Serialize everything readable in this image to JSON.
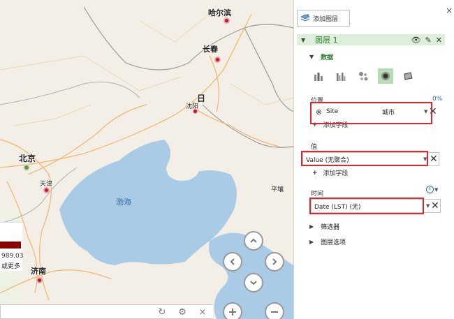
{
  "map": {
    "cities": {
      "haerbin": "哈尔滨",
      "changchun": "长春",
      "shenyang": "沈阳",
      "beijing": "北京",
      "tianjin": "天津",
      "jinan": "济南",
      "pingrang": "平壤",
      "ri": "日"
    },
    "sea": "渤海",
    "legend": {
      "value": "989.03",
      "more": "或更多"
    }
  },
  "pane": {
    "close": "×",
    "add_layer": "添加图层",
    "layer_name": "图层 1",
    "data_section": "数据",
    "location_label": "位置",
    "location_pct": "0%",
    "location_field": "Site",
    "location_type": "城市",
    "add_field": "添加字段",
    "value_label": "值",
    "value_field": "Value (无聚合)",
    "time_label": "时间",
    "time_field": "Date (LST) (无)",
    "filters": "筛选器",
    "layer_options": "图层选项"
  },
  "colors": {
    "accent_green": "#2e7d32",
    "header_green": "#dcefd8",
    "highlight_red": "#e0262e",
    "marker_red": "#c8102e"
  }
}
